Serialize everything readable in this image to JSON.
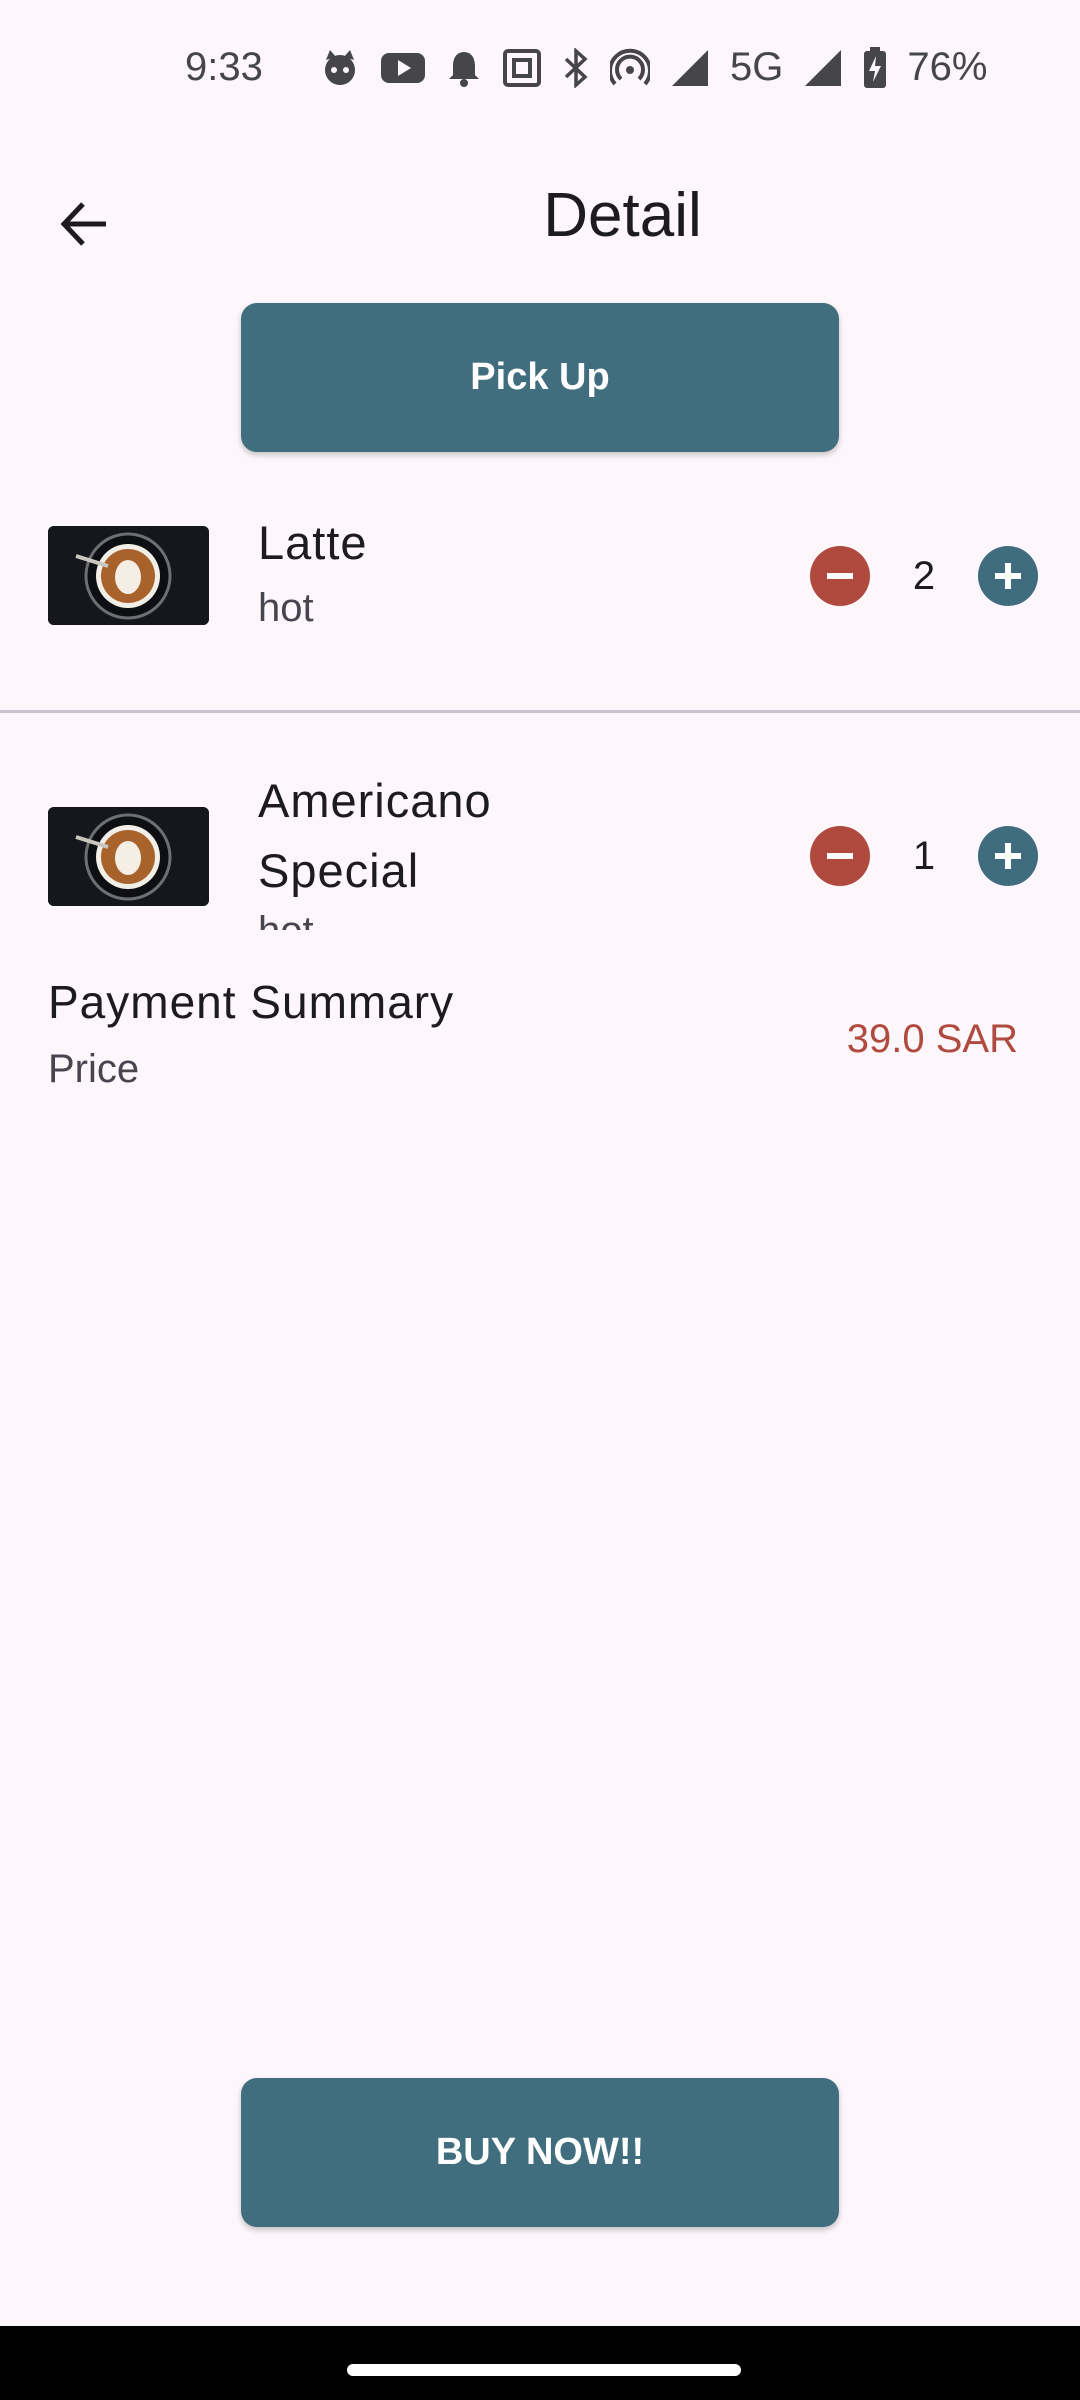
{
  "status_bar": {
    "time": "9:33",
    "network": "5G",
    "battery": "76%"
  },
  "app_bar": {
    "title": "Detail",
    "back_icon": "arrow-back-icon"
  },
  "pickup_button": {
    "label": "Pick Up"
  },
  "items": [
    {
      "name": "Latte",
      "type": "hot",
      "quantity": "2"
    },
    {
      "name": "Americano Special",
      "type": "hot",
      "quantity": "1"
    }
  ],
  "payment": {
    "title": "Payment Summary",
    "price_label": "Price",
    "price_value": "39.0 SAR"
  },
  "buy_button": {
    "label": "BUY NOW!!"
  },
  "colors": {
    "primary": "#406e7e",
    "minus": "#b04a3e",
    "price": "#b04a3e",
    "background": "#fdf7fc"
  }
}
